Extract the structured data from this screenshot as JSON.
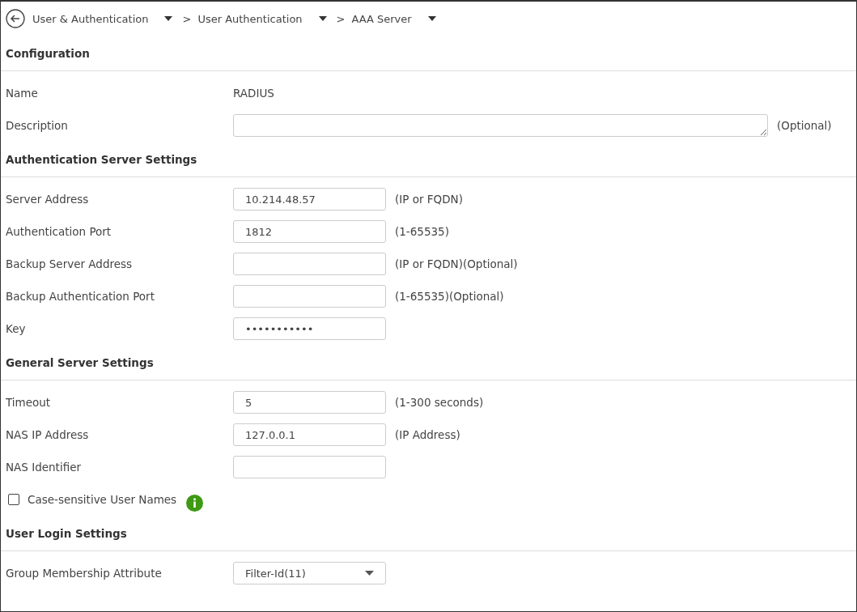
{
  "breadcrumb": [
    {
      "label": "User & Authentication"
    },
    {
      "separator": ">",
      "label": "User Authentication"
    },
    {
      "separator": ">",
      "label": "AAA Server"
    }
  ],
  "sections": [
    {
      "title": "Configuration",
      "rows": [
        {
          "kind": "static",
          "label": "Name",
          "value": "RADIUS"
        },
        {
          "kind": "textarea",
          "label": "Description",
          "hint": "(Optional)"
        }
      ]
    },
    {
      "title": "Authentication Server Settings",
      "rows": [
        {
          "kind": "input",
          "label": "Server Address",
          "value": "10.214.48.57",
          "hint": "(IP or FQDN)"
        },
        {
          "kind": "input",
          "label": "Authentication Port",
          "value": "1812",
          "hint": "(1-65535)"
        },
        {
          "kind": "input",
          "label": "Backup Server Address",
          "hint": "(IP or FQDN)(Optional)"
        },
        {
          "kind": "input",
          "label": "Backup Authentication Port",
          "hint": "(1-65535)(Optional)"
        },
        {
          "kind": "input",
          "label": "Key",
          "value": "•••••••••••"
        }
      ]
    },
    {
      "title": "General Server Settings",
      "rows": [
        {
          "kind": "input",
          "label": "Timeout",
          "value": "5",
          "hint": "(1-300 seconds)"
        },
        {
          "kind": "input",
          "label": "NAS IP Address",
          "value": "127.0.0.1",
          "hint": "(IP Address)"
        },
        {
          "kind": "input",
          "label": "NAS Identifier"
        },
        {
          "kind": "checkbox",
          "label": "Case-sensitive User Names",
          "checked": false
        }
      ]
    },
    {
      "title": "User Login Settings",
      "rows": [
        {
          "kind": "select",
          "label": "Group Membership Attribute",
          "value": "Filter-Id(11)"
        }
      ]
    }
  ]
}
